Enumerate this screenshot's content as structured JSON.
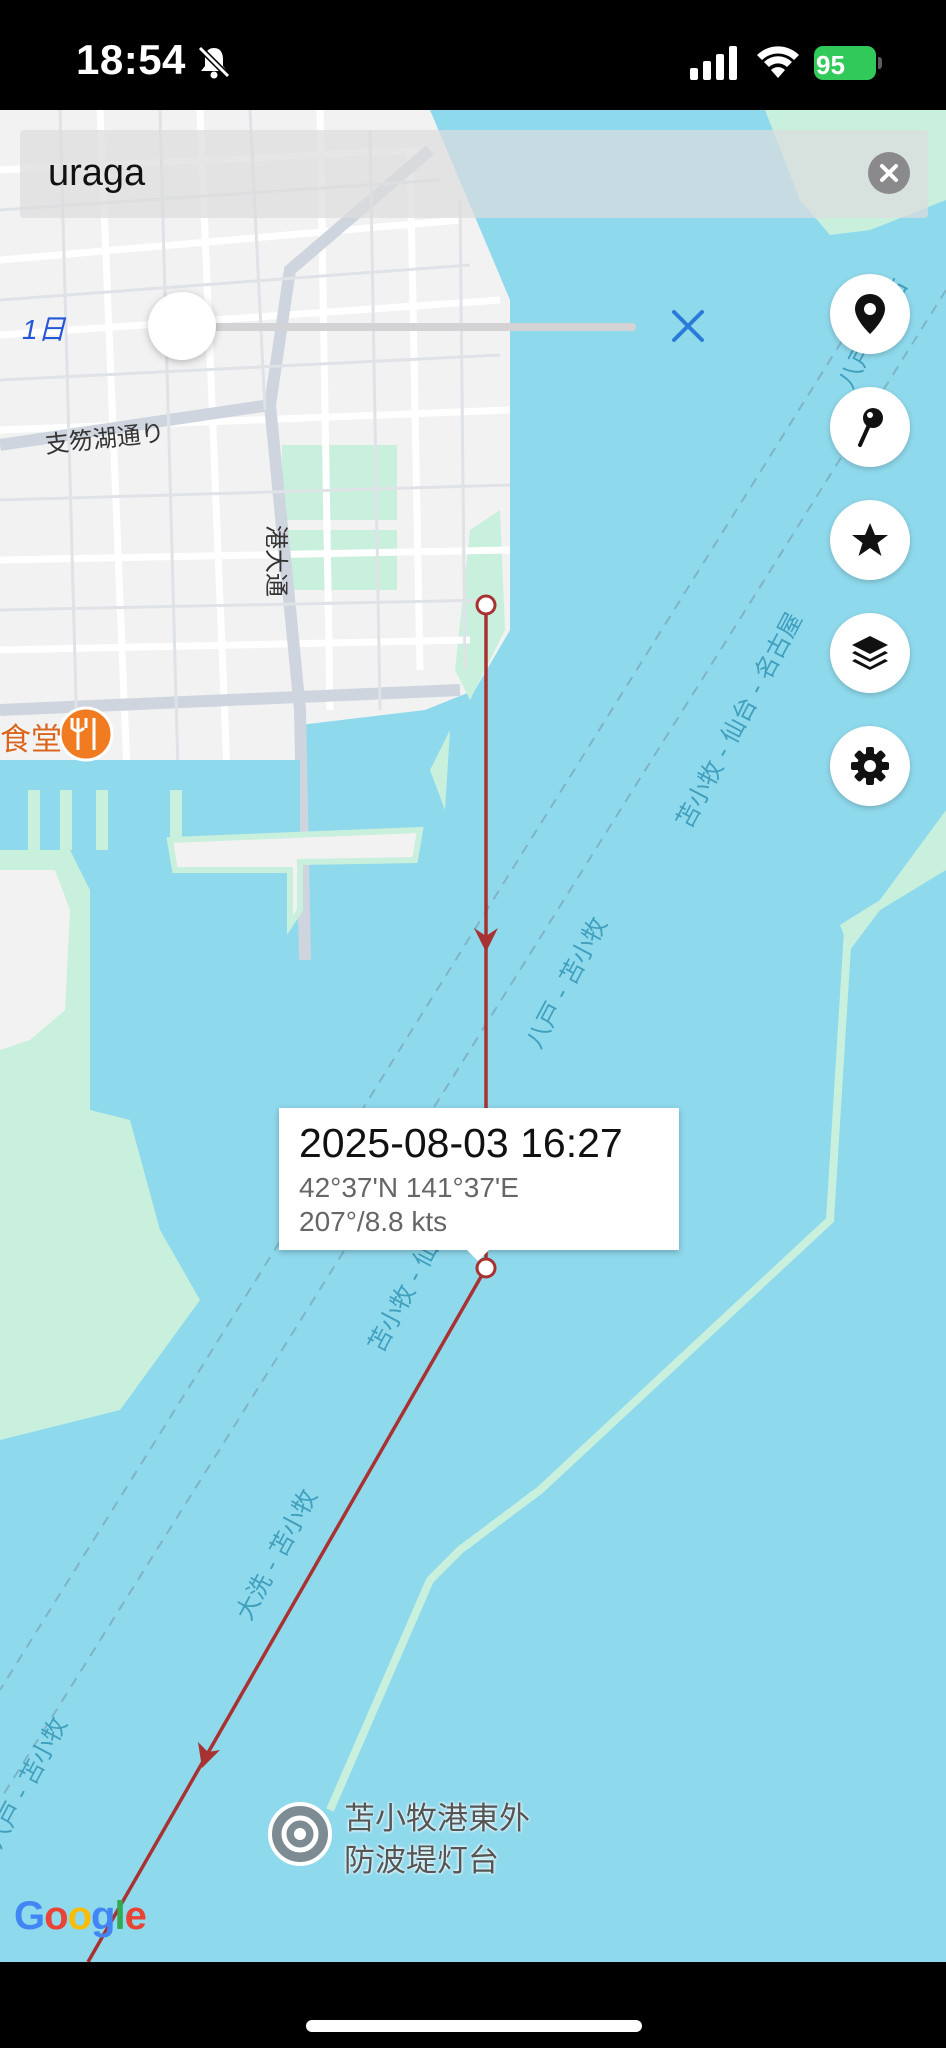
{
  "status_bar": {
    "time": "18:54",
    "battery": "95",
    "icons": [
      "bell-slash-icon",
      "signal-icon",
      "wifi-icon",
      "battery-charging-icon"
    ]
  },
  "search": {
    "value": "uraga",
    "clear_icon": "clear-icon"
  },
  "slider": {
    "label": "1日",
    "close_icon": "close-icon"
  },
  "actions": [
    {
      "name": "location-pin-button",
      "icon": "location-pin-icon"
    },
    {
      "name": "pin-button",
      "icon": "pushpin-icon"
    },
    {
      "name": "favorites-button",
      "icon": "star-icon"
    },
    {
      "name": "layers-button",
      "icon": "layers-icon"
    },
    {
      "name": "settings-button",
      "icon": "gear-icon"
    }
  ],
  "popup": {
    "title": "2025-08-03 16:27",
    "coords": "42°37'N 141°37'E",
    "course": "207°/8.8 kts"
  },
  "map_labels": {
    "street1": "支笏湖通り",
    "street2": "港大通",
    "restaurant": "食堂",
    "route1": "苫小牧 - 仙台 - 名古屋",
    "route2": "八戸 - 苫小牧",
    "route3": "苫小牧 - 仙",
    "route4": "大洗 - 苫小牧",
    "route5": "八戸 - 苫小牧",
    "route6": "八戸 - 名古",
    "lighthouse_line1": "苫小牧港東外",
    "lighthouse_line2": "防波堤灯台"
  },
  "google_logo": "Google",
  "colors": {
    "water": "#8fd9ec",
    "land": "#f2f2f3",
    "park": "#c9f0dd",
    "track": "#a83232",
    "accent": "#2b7bd8"
  }
}
